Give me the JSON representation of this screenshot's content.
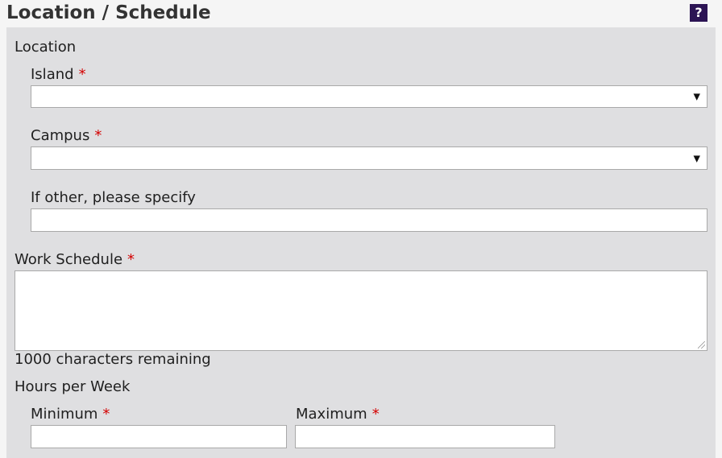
{
  "header": {
    "title": "Location / Schedule",
    "help_label": "?"
  },
  "location": {
    "section_label": "Location",
    "island": {
      "label": "Island",
      "required_mark": "*",
      "value": ""
    },
    "campus": {
      "label": "Campus",
      "required_mark": "*",
      "value": ""
    },
    "other": {
      "label": "If other, please specify",
      "value": ""
    }
  },
  "work_schedule": {
    "label": "Work Schedule",
    "required_mark": "*",
    "value": "",
    "chars_remaining": "1000 characters remaining"
  },
  "hours": {
    "section_label": "Hours per Week",
    "minimum": {
      "label": "Minimum",
      "required_mark": "*",
      "value": ""
    },
    "maximum": {
      "label": "Maximum",
      "required_mark": "*",
      "value": ""
    }
  },
  "icons": {
    "dropdown": "chevron-down-icon",
    "resize": "resize-grip-icon"
  },
  "colors": {
    "panel_bg": "#dfdfe1",
    "header_bg": "#f5f5f5",
    "help_bg": "#2c1454",
    "required": "#d40000"
  }
}
